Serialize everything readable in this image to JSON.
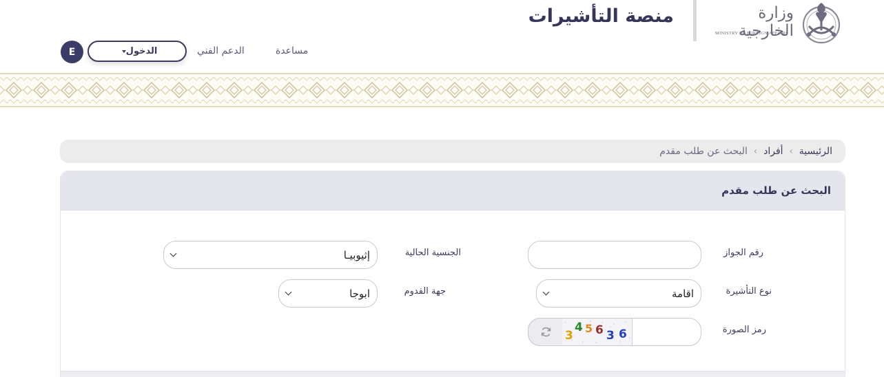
{
  "header": {
    "ministry_name_ar": "وزارة الخارجية",
    "ministry_name_en": "MINISTRY OF FOREIGN AFFAIRS",
    "platform_title": "منصة التأشيرات",
    "nav": {
      "help": "مساعدة",
      "support": "الدعم الفني"
    },
    "login_label": "الدخول",
    "language_label": "E"
  },
  "breadcrumb": {
    "home": "الرئيسية",
    "individuals": "أفراد",
    "current": "البحث عن طلب مقدم"
  },
  "form": {
    "title": "البحث عن طلب مقدم",
    "passport_label": "رقم الجواز",
    "passport_value": "",
    "nationality_label": "الجنسية الحالية",
    "nationality_value": "إثيوبيـا",
    "visa_type_label": "نوع التأشيرة",
    "visa_type_value": "اقامة",
    "arrival_label": "جهة القدوم",
    "arrival_value": "ابوجا",
    "captcha_label": "رمز الصورة",
    "captcha_value": "",
    "captcha_chars": [
      "3",
      "4",
      "5",
      "6",
      "3",
      "6"
    ]
  },
  "colors": {
    "primary": "#3d3c68",
    "gold_pattern": "#c8b98a",
    "header_bg": "#e5e5ee"
  },
  "icons": {
    "emblem": "saudi-emblem-icon",
    "refresh": "refresh-icon",
    "caret": "caret-down-icon"
  }
}
